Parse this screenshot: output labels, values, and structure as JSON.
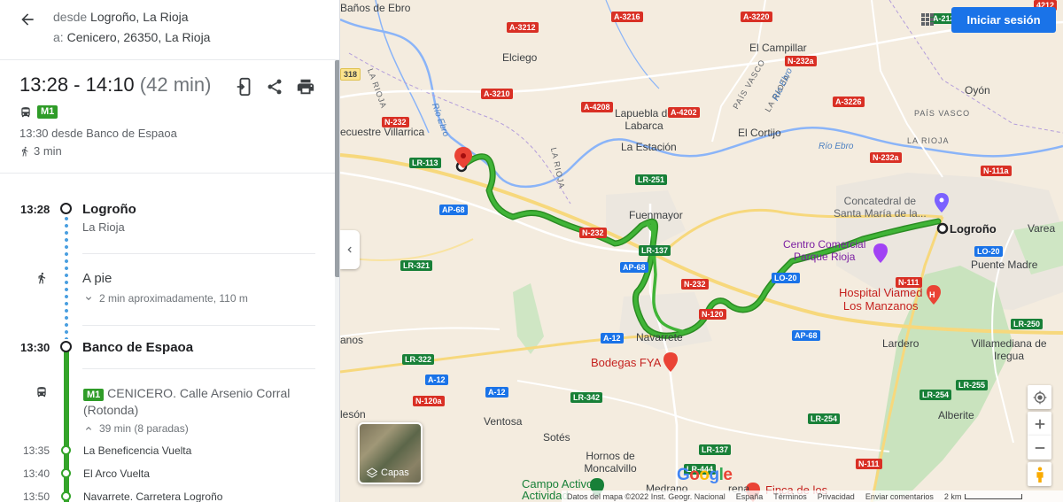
{
  "header": {
    "from_prefix": "desde",
    "from_value": "Logroño, La Rioja",
    "to_prefix": "a:",
    "to_value": "Cenicero, 26350, La Rioja"
  },
  "summary": {
    "time_range": "13:28 - 14:10",
    "duration": "(42 min)",
    "line_badge": "M1",
    "departure": "13:30 desde Banco de Espaoa",
    "walk": "3 min"
  },
  "steps": [
    {
      "time": "13:28",
      "name": "Logroño",
      "sub": "La Rioja"
    },
    {
      "mode": "A pie",
      "detail": "2 min aproximadamente, 110 m"
    },
    {
      "time": "13:30",
      "name": "Banco de Espaoa"
    },
    {
      "badge": "M1",
      "title": "CENICERO. Calle Arsenio Corral (Rotonda)",
      "detail": "39 min (8 paradas)"
    }
  ],
  "intermediate_stops": [
    {
      "time": "13:35",
      "name": "La Beneficencia Vuelta"
    },
    {
      "time": "13:40",
      "name": "El Arco Vuelta"
    },
    {
      "time": "13:50",
      "name": "Navarrete. Carretera Logroño"
    }
  ],
  "map": {
    "towns": {
      "banos": "Baños de Ebro",
      "elciego": "Elciego",
      "campillar": "El Campillar",
      "lapuebla": "Lapuebla de Labarca",
      "laestacion": "La Estación",
      "elcortijo": "El Cortijo",
      "oyon": "Oyón",
      "fuenmayor": "Fuenmayor",
      "navarrete": "Navarrete",
      "logrono": "Logroño",
      "varea": "Varea",
      "puentemadre": "Puente Madre",
      "lardero": "Lardero",
      "villamediana": "Villamediana de Iregua",
      "alberite": "Alberite",
      "ventosa": "Ventosa",
      "sotes": "Sotés",
      "hornos": "Hornos de Moncalvillo",
      "medrano": "Medrano",
      "lavillarrica": "ecuestre Villarrica",
      "aleson": "lesón",
      "anos": "anos",
      "ecuestre_edge": "ecuestre Villarrica",
      "paisvasco1": "PAÍS VASCO",
      "paisvasco2": "PAÍS VASCO",
      "larioja1": "LA RIOJA",
      "larioja2": "LA RIOJA",
      "larioja3": "LA RIOJA",
      "larioja4": "LA RIOJA",
      "trena": "rena"
    },
    "pois": {
      "concatedral": "Concatedral de\nSanta María de la...",
      "centro": "Centro Comercial\nParque Rioja",
      "hospital": "Hospital Viamed\nLos Manzanos",
      "bodegas": "Bodegas FYA",
      "campo": "Campo Activo\nActividad...",
      "finca": "Finca de los"
    },
    "rivers": {
      "ebro1": "Río Ebro",
      "ebro2": "Río Ebro",
      "ebro3": "Río Ebro"
    },
    "roads": [
      "A-3216",
      "A-3220",
      "A-3212",
      "N-232a",
      "A-3210",
      "A-4208",
      "A-4202",
      "A-3226",
      "N-111a",
      "N-232",
      "LR-113",
      "LR-251",
      "N-232a",
      "AP-68",
      "N-232",
      "LR-137",
      "AP-68",
      "LR-321",
      "N-232",
      "LO-20",
      "LO-20",
      "N-120",
      "A-12",
      "AP-68",
      "N-111",
      "LR-322",
      "A-12",
      "LR-342",
      "N-120a",
      "A-12",
      "LR-250",
      "LR-254",
      "LR-255",
      "LR-254",
      "LR-137",
      "N-111",
      "LR-444",
      "318",
      "4212",
      "A-2126"
    ],
    "signin": "Iniciar sesión",
    "layers": "Capas",
    "google": "Google",
    "footer": {
      "data": "Datos del mapa ©2022 Inst. Geogr. Nacional",
      "country": "España",
      "terms": "Términos",
      "privacy": "Privacidad",
      "feedback": "Enviar comentarios",
      "scale": "2 km"
    }
  },
  "colors": {
    "route": "#34a42a",
    "walk": "#4a9fe0",
    "signin": "#1a73e8",
    "badge": "#2f9c28"
  }
}
